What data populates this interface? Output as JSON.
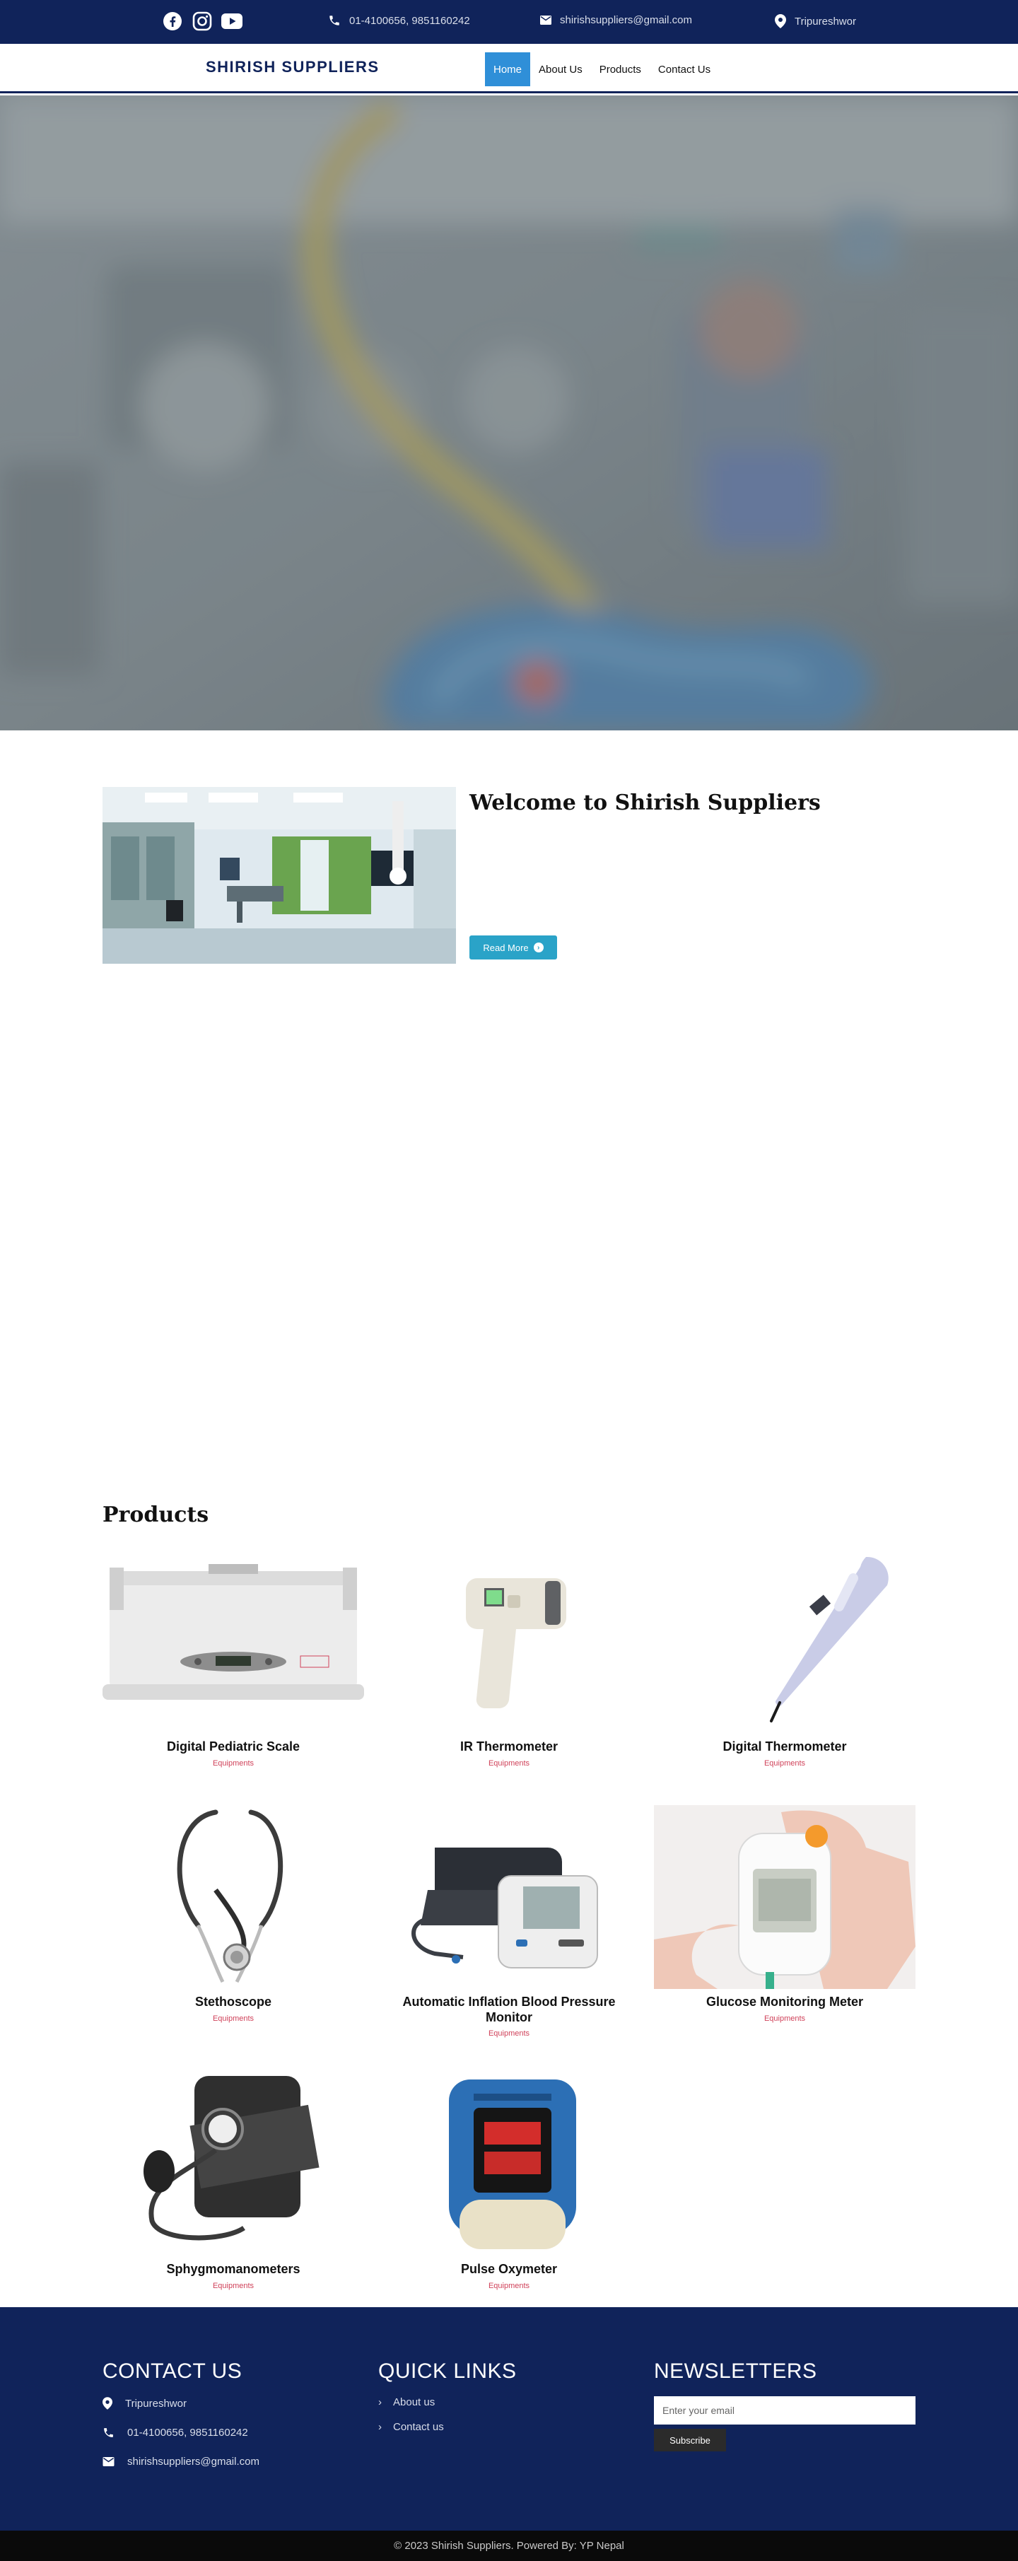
{
  "topbar": {
    "social": [
      "facebook-icon",
      "instagram-icon",
      "youtube-icon"
    ],
    "phone": "01-4100656, 9851160242",
    "email": "shirishsuppliers@gmail.com",
    "location": "Tripureshwor"
  },
  "nav": {
    "brand": "SHIRISH SUPPLIERS",
    "items": [
      {
        "label": "Home",
        "active": true
      },
      {
        "label": "About Us",
        "active": false
      },
      {
        "label": "Products",
        "active": false
      },
      {
        "label": "Contact Us",
        "active": false
      }
    ]
  },
  "welcome": {
    "title": "Welcome to Shirish Suppliers",
    "button": "Read More"
  },
  "products": {
    "title": "Products",
    "items": [
      {
        "name": "Digital Pediatric Scale",
        "category": "Equipments"
      },
      {
        "name": "IR Thermometer",
        "category": "Equipments"
      },
      {
        "name": "Digital Thermometer",
        "category": "Equipments"
      },
      {
        "name": "Stethoscope",
        "category": "Equipments"
      },
      {
        "name": "Automatic Inflation Blood Pressure Monitor",
        "category": "Equipments"
      },
      {
        "name": "Glucose Monitoring Meter",
        "category": "Equipments"
      },
      {
        "name": "Sphygmomanometers",
        "category": "Equipments"
      },
      {
        "name": "Pulse Oxymeter",
        "category": "Equipments"
      }
    ]
  },
  "footer": {
    "contact": {
      "title": "CONTACT US",
      "location": "Tripureshwor",
      "phone": "01-4100656, 9851160242",
      "email": "shirishsuppliers@gmail.com"
    },
    "links": {
      "title": "QUICK LINKS",
      "items": [
        "About us",
        "Contact us"
      ]
    },
    "newsletter": {
      "title": "NEWSLETTERS",
      "placeholder": "Enter your email",
      "button": "Subscribe"
    },
    "copyright": "© 2023 Shirish Suppliers. Powered By: YP Nepal"
  },
  "colors": {
    "primary": "#10235a",
    "nav_active": "#2f8fd8",
    "read_more": "#2aa3c8",
    "category": "#d0425a"
  }
}
